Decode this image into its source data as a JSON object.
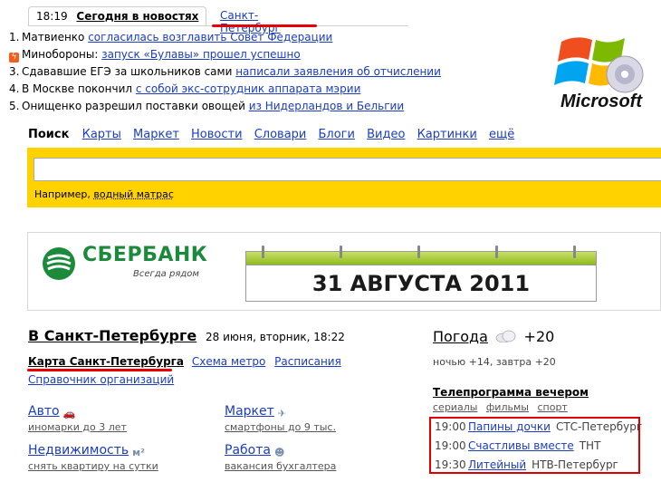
{
  "news": {
    "time": "18:19",
    "tab_title": "Сегодня в новостях",
    "tab_city": "Санкт-Петербург",
    "items": [
      {
        "marker": "1.",
        "text": "Матвиенко ",
        "link": "согласилась возглавить Совет Федерации"
      },
      {
        "marker": "flash",
        "text": "Минобороны: ",
        "link": "запуск «Булавы» прошел успешно"
      },
      {
        "marker": "3.",
        "text": "Сдававшие ЕГЭ за школьников сами ",
        "link": "написали заявления об отчислении"
      },
      {
        "marker": "4.",
        "text": "В Москве покончил ",
        "link": "с собой экс-сотрудник аппарата мэрии"
      },
      {
        "marker": "5.",
        "text": "Онищенко разрешил поставки овощей ",
        "link": "из Нидерландов и Бельгии"
      }
    ]
  },
  "logo": {
    "text": "Microsoft"
  },
  "search": {
    "current": "Поиск",
    "services": [
      "Карты",
      "Маркет",
      "Новости",
      "Словари",
      "Блоги",
      "Видео",
      "Картинки",
      "ещё"
    ],
    "input_value": "",
    "hint_prefix": "Например, ",
    "hint_example": "водный матрас"
  },
  "banner": {
    "brand": "СБЕРБАНК",
    "slogan": "Всегда рядом",
    "date": "31 АВГУСТА 2011"
  },
  "city": {
    "title": "В Санкт-Петербурге",
    "date": "28 июня, вторник, 18:22",
    "map_link": "Карта Санкт-Петербурга",
    "metro_link": "Схема метро",
    "schedule_link": "Расписания",
    "orgs_link": "Справочник организаций",
    "services": [
      {
        "title": "Авто",
        "desc": "иномарки до 3 лет",
        "icon": "car-icon"
      },
      {
        "title": "Маркет",
        "desc": "смартфоны до 9 тыс.",
        "icon": "plane-icon"
      },
      {
        "title": "Недвижимость",
        "desc": "снять квартиру на сутки",
        "icon": "square-meter-icon",
        "icon_text": "м²"
      },
      {
        "title": "Работа",
        "desc": "вакансия бухгалтера",
        "icon": "worker-icon"
      }
    ]
  },
  "weather": {
    "title": "Погода",
    "temp": "+20",
    "forecast": "ночью +14,  завтра +20",
    "icon": "cloud-icon"
  },
  "tv": {
    "title": "Телепрограмма вечером",
    "categories": [
      "сериалы",
      "фильмы",
      "спорт"
    ],
    "rows": [
      {
        "time": "19:00",
        "show": "Папины дочки",
        "channel": "СТС-Петербург"
      },
      {
        "time": "19:00",
        "show": "Счастливы вместе",
        "channel": "ТНТ"
      },
      {
        "time": "19:30",
        "show": "Литейный",
        "channel": "НТВ-Петербург"
      }
    ]
  },
  "colors": {
    "link": "#1a3dc1",
    "search_bg": "#ffd200",
    "highlight": "#e60000",
    "brand_green": "#1b8a3a"
  }
}
